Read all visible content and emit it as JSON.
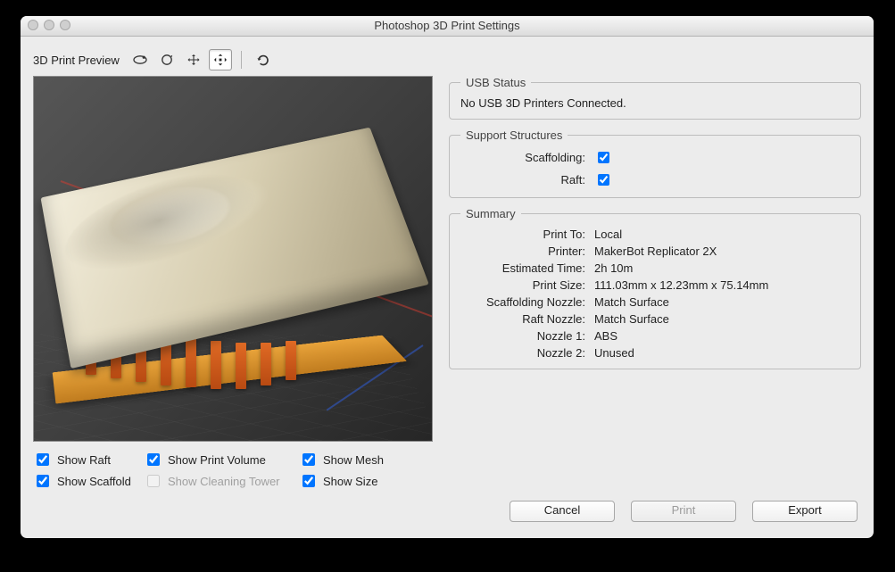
{
  "window": {
    "title": "Photoshop 3D Print Settings"
  },
  "toolbar": {
    "title": "3D Print Preview"
  },
  "usb_status": {
    "legend": "USB Status",
    "message": "No USB 3D Printers Connected."
  },
  "support": {
    "legend": "Support Structures",
    "scaffolding_label": "Scaffolding:",
    "scaffolding_checked": true,
    "raft_label": "Raft:",
    "raft_checked": true
  },
  "summary": {
    "legend": "Summary",
    "rows": {
      "print_to": {
        "k": "Print To:",
        "v": "Local"
      },
      "printer": {
        "k": "Printer:",
        "v": "MakerBot Replicator 2X"
      },
      "estimated_time": {
        "k": "Estimated Time:",
        "v": "2h 10m"
      },
      "print_size": {
        "k": "Print Size:",
        "v": "111.03mm x 12.23mm x 75.14mm"
      },
      "scaff_nozzle": {
        "k": "Scaffolding Nozzle:",
        "v": "Match Surface"
      },
      "raft_nozzle": {
        "k": "Raft Nozzle:",
        "v": "Match Surface"
      },
      "nozzle1": {
        "k": "Nozzle 1:",
        "v": "ABS"
      },
      "nozzle2": {
        "k": "Nozzle 2:",
        "v": "Unused"
      }
    }
  },
  "show": {
    "raft": {
      "label": "Show Raft",
      "checked": true
    },
    "print_volume": {
      "label": "Show Print Volume",
      "checked": true
    },
    "mesh": {
      "label": "Show Mesh",
      "checked": true
    },
    "scaffold": {
      "label": "Show Scaffold",
      "checked": true
    },
    "cleaning_tower": {
      "label": "Show Cleaning Tower",
      "checked": false,
      "disabled": true
    },
    "size": {
      "label": "Show Size",
      "checked": true
    }
  },
  "buttons": {
    "cancel": "Cancel",
    "print": "Print",
    "export": "Export"
  }
}
